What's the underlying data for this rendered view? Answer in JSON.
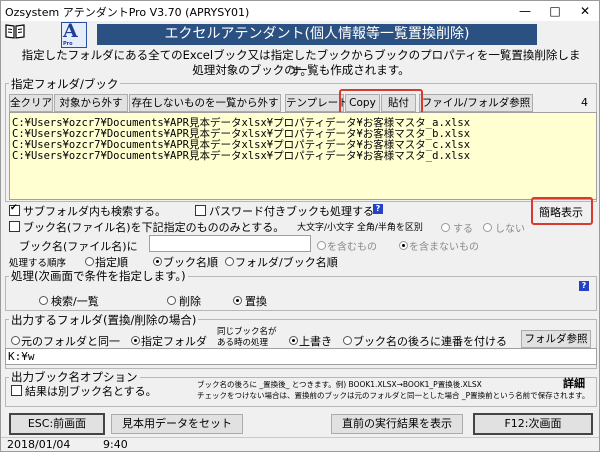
{
  "title": "Ozsystem アテンダントPro V3.70 (APRYSY01)",
  "window_controls": {
    "minimize": "—",
    "maximize": "□",
    "close": "✕"
  },
  "logo": {
    "letter": "A",
    "sub": "Pro"
  },
  "banner": "エクセルアテンダント(個人情報等一覧置換削除)",
  "desc_line1": "指定したフォルダにある全てのExcelブック又は指定したブックからブックのプロパティを一覧置換削除します。",
  "desc_line2": "処理対象のブックの一覧も作成されます。",
  "folder_section": {
    "legend": "指定フォルダ/ブック",
    "buttons": {
      "clear_all": "全クリア",
      "remove": "対象から外す",
      "remove_missing": "存在しないものを一覧から外す",
      "template": "テンプレート",
      "copy": "Copy",
      "paste": "貼付",
      "browse": "ファイル/フォルダ参照"
    },
    "count": "4",
    "files": [
      "C:¥Users¥ozcr7¥Documents¥APR見本データxlsx¥プロパティデータ¥お客様マスタ_a.xlsx",
      "C:¥Users¥ozcr7¥Documents¥APR見本データxlsx¥プロパティデータ¥お客様マスタ_b.xlsx",
      "C:¥Users¥ozcr7¥Documents¥APR見本データxlsx¥プロパティデータ¥お客様マスタ_c.xlsx",
      "C:¥Users¥ozcr7¥Documents¥APR見本データxlsx¥プロパティデータ¥お客様マスタ_d.xlsx"
    ]
  },
  "options": {
    "subfolders": "サブフォルダ内も検索する。",
    "password_books": "パスワード付きブックも処理する",
    "help": "?",
    "brief": "簡略表示",
    "filename_filter": "ブック名(ファイル名)を下記指定のもののみとする。",
    "case_label": "大文字/小文字 全角/半角を区別",
    "case_yes": "する",
    "case_no": "しない",
    "filename_label": "ブック名(ファイル名)に",
    "contains": "を含むもの",
    "not_contains": "を含まないもの",
    "order_label": "処理する順序",
    "order_specified": "指定順",
    "order_book": "ブック名順",
    "order_folder": "フォルダ/ブック名順"
  },
  "process_section": {
    "legend": "処理(次画面で条件を指定します。)",
    "search": "検索/一覧",
    "delete": "削除",
    "replace": "置換",
    "help": "?"
  },
  "output_section": {
    "legend": "出力するフォルダ(置換/削除の場合)",
    "same_folder": "元のフォルダと同一",
    "specified_folder": "指定フォルダ",
    "same_name_label1": "同じブック名が",
    "same_name_label2": "ある時の処理",
    "overwrite": "上書き",
    "serial": "ブック名の後ろに連番を付ける",
    "folder_browse": "フォルダ参照",
    "path": "K:¥w"
  },
  "output_name_section": {
    "legend": "出力ブック名オプション",
    "separate_name": "結果は別ブック名とする。",
    "note1": "ブック名の後ろに _置換後_ とつきます。例) BOOK1.XLSX→BOOK1_P置換後.XLSX",
    "note2": "チェックをつけない場合は、置換前のブックは元のフォルダと同一とした場合 _P置換前という名前で保存されます。",
    "detail": "詳細"
  },
  "bottom_buttons": {
    "esc": "ESC:前画面",
    "sample": "見本用データをセット",
    "last_result": "直前の実行結果を表示",
    "f12": "F12:次画面"
  },
  "status": {
    "date": "2018/01/04",
    "time": "9:40"
  }
}
